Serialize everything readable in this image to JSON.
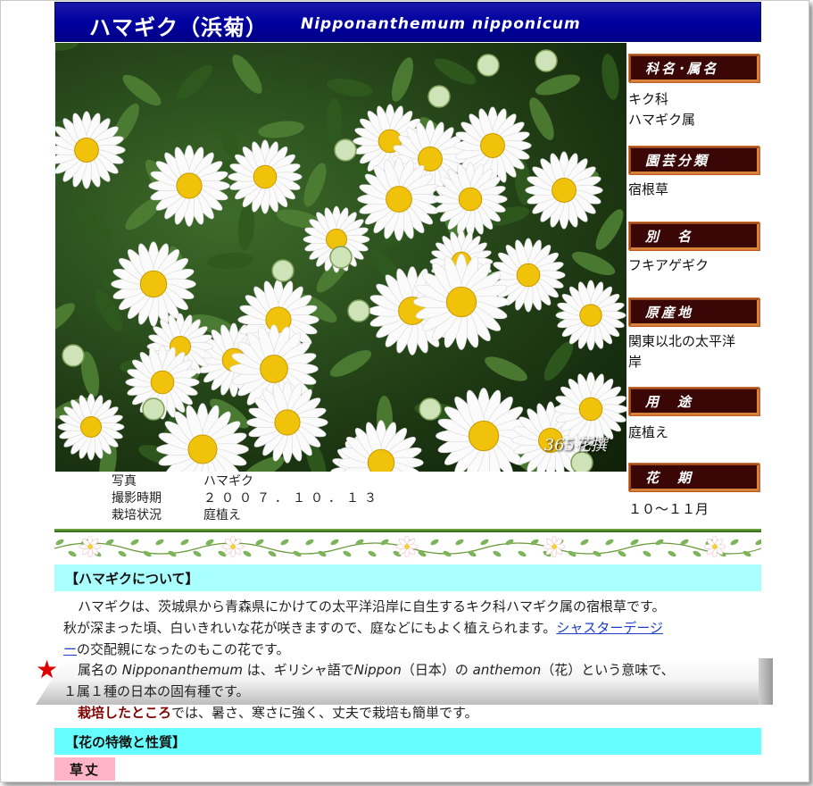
{
  "header": {
    "title_ja": "ハマギク（浜菊）",
    "title_sci": "Nipponanthemum nipponicum"
  },
  "photo": {
    "watermark": "365花撰"
  },
  "caption": {
    "rows": [
      {
        "label": "写真",
        "value": "ハマギク"
      },
      {
        "label": "撮影時期",
        "value": "２００７．１０．１３"
      },
      {
        "label": "栽培状況",
        "value": "庭植え"
      }
    ]
  },
  "sidebar": {
    "items": [
      {
        "label": "科名･属名",
        "value_lines": [
          "キク科",
          "ハマギク属"
        ]
      },
      {
        "label": "園芸分類",
        "value_lines": [
          "宿根草"
        ]
      },
      {
        "label": "別　名",
        "value_lines": [
          "フキアゲギク"
        ]
      },
      {
        "label": "原産地",
        "value_lines": [
          "関東以北の太平洋",
          "岸"
        ]
      },
      {
        "label": "用　途",
        "value_lines": [
          "庭植え"
        ]
      },
      {
        "label": "花　期",
        "value_lines": [
          "１０～１１月"
        ]
      }
    ]
  },
  "about": {
    "heading": "【ハマギクについて】",
    "p1_line1": "ハマギクは、茨城県から青森県にかけての太平洋沿岸に自生するキク科ハマギク属の宿根草です。",
    "p1_line2_pre": "秋が深まった頃、白いきれいな花が咲きますので、庭などにもよく植えられます。",
    "p1_link": "シャスターデージ",
    "p1_line3_link": "ー",
    "p1_line3_post": "の交配親になったのもこの花です。",
    "p2_pre": "属名の ",
    "p2_genus": "Nipponanthemum",
    "p2_mid1": " は、ギリシャ語で",
    "p2_word1": "Nippon",
    "p2_mid2": "（日本）の ",
    "p2_word2": "anthemon",
    "p2_post": "（花）という意味で、",
    "p2_line2": "１属１種の日本の固有種です。",
    "p3_bold": "栽培したところ",
    "p3_post": "では、暑さ、寒さに強く、丈夫で栽培も簡単です。"
  },
  "features": {
    "heading": "【花の特徴と性質】",
    "subheading": "草丈"
  },
  "colors": {
    "title_bg": "#0000a0",
    "side_head_bg": "#3a0606",
    "section_bg": "#aaffff",
    "accent_star": "#e00000",
    "subhead_bg": "#ffb4c8"
  }
}
